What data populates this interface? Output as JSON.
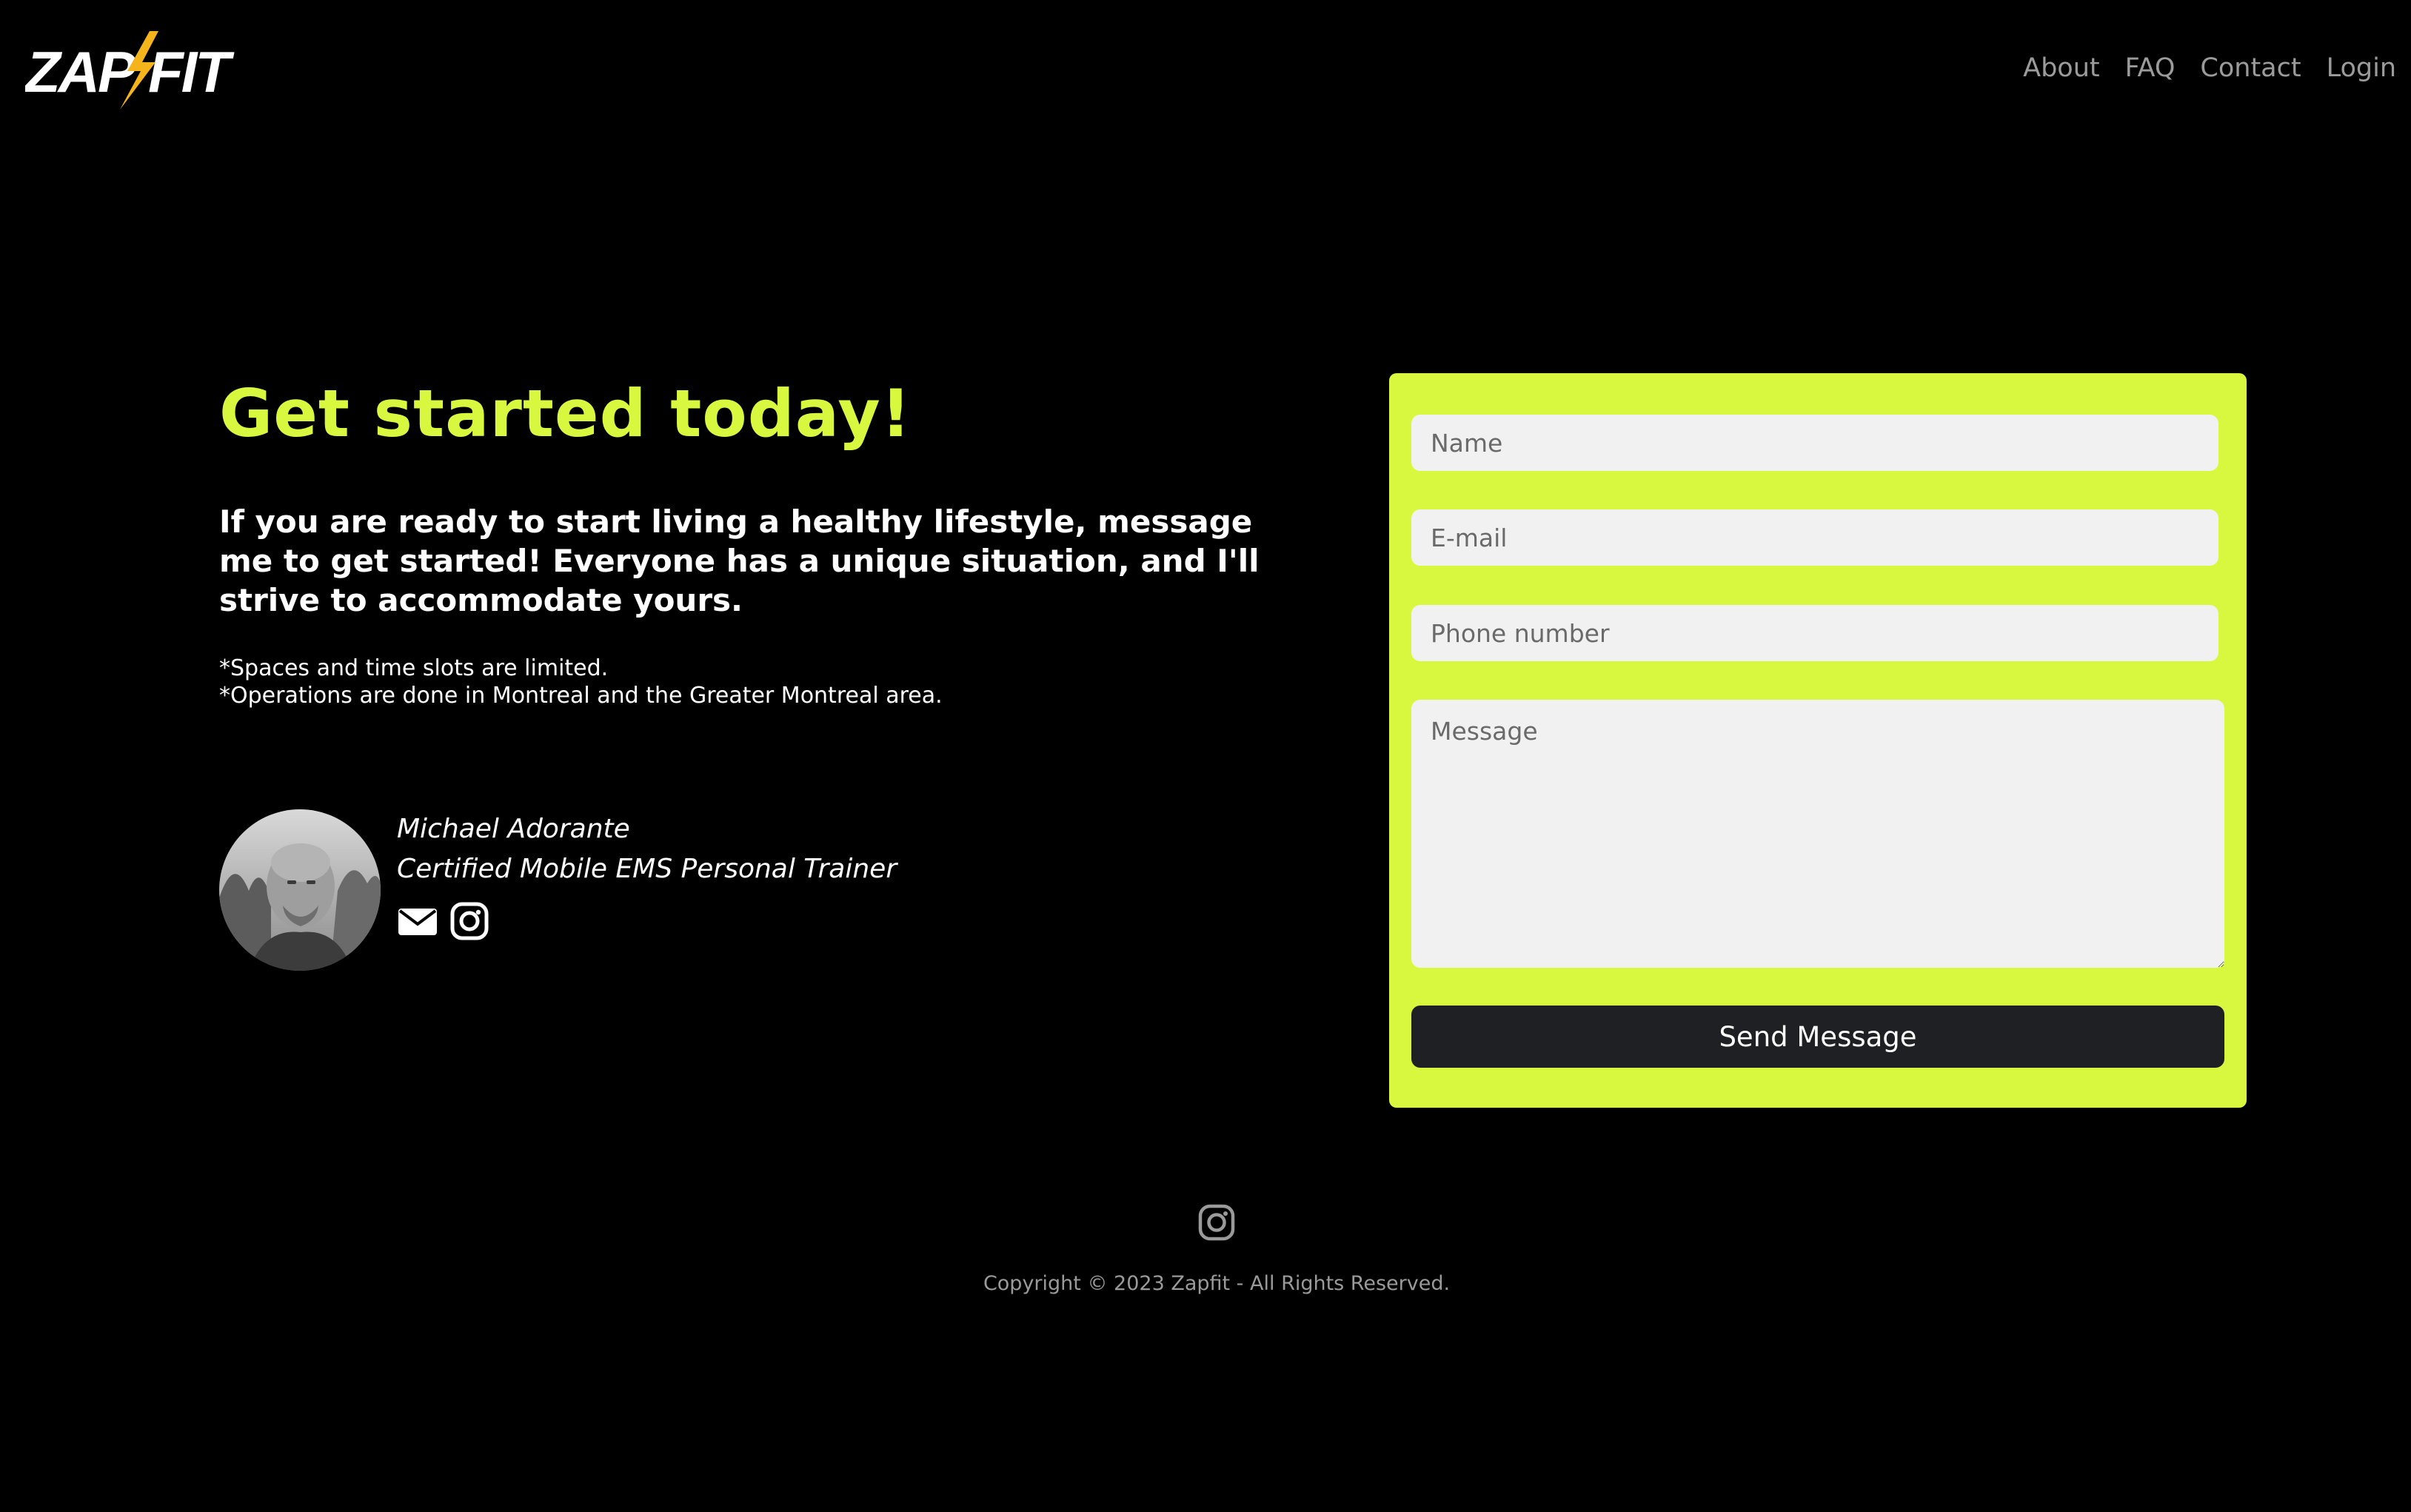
{
  "header": {
    "logo_text": "ZAP FIT",
    "nav": [
      {
        "label": "About"
      },
      {
        "label": "FAQ"
      },
      {
        "label": "Contact"
      },
      {
        "label": "Login"
      }
    ]
  },
  "hero": {
    "headline": "Get started today!",
    "lede": "If you are ready to start living a healthy lifestyle, message me to get started! Everyone has a unique situation, and I'll strive to accommodate yours.",
    "notes": [
      "*Spaces and time slots are limited.",
      "*Operations are done in Montreal and the Greater Montreal area."
    ]
  },
  "trainer": {
    "name": "Michael Adorante",
    "title": "Certified Mobile EMS Personal Trainer",
    "icons": [
      "envelope-icon",
      "instagram-icon"
    ]
  },
  "form": {
    "name_placeholder": "Name",
    "email_placeholder": "E-mail",
    "phone_placeholder": "Phone number",
    "message_placeholder": "Message",
    "submit_label": "Send Message"
  },
  "footer": {
    "icon": "instagram-icon",
    "copyright": "Copyright © 2023 Zapfit - All Rights Reserved."
  },
  "colors": {
    "background": "#000000",
    "accent": "#d8f83f",
    "logo_bolt": "#f6b41c",
    "button": "#1f2023",
    "nav_text": "#9b9b9b"
  }
}
